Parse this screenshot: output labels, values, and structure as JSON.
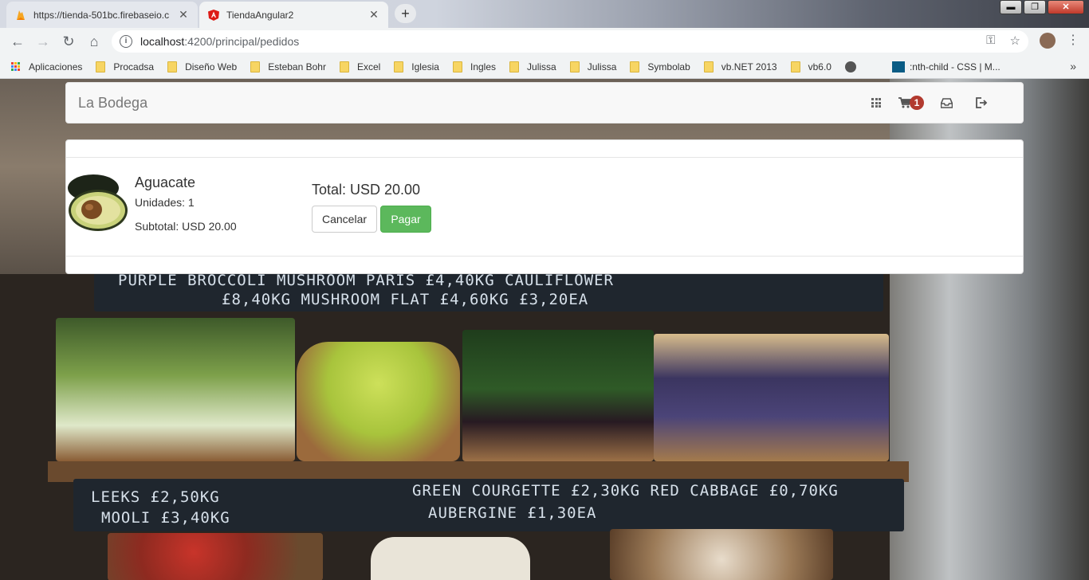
{
  "browser": {
    "tabs": [
      {
        "title": "https://tienda-501bc.firebaseio.c",
        "active": false,
        "icon": "firebase-icon"
      },
      {
        "title": "TiendaAngular2",
        "active": true,
        "icon": "angular-icon"
      }
    ],
    "new_tab": "+",
    "window_controls": {
      "minimize": "▬",
      "maximize": "❐",
      "close": "✕"
    },
    "url_host": "localhost",
    "url_path": ":4200/principal/pedidos",
    "bookmarks": [
      "Aplicaciones",
      "Procadsa",
      "Diseño Web",
      "Esteban Bohr",
      "Excel",
      "Iglesia",
      "Ingles",
      "Julissa",
      "Julissa",
      "Symbolab",
      "vb.NET 2013",
      "vb6.0",
      ":nth-child - CSS | M..."
    ],
    "bookmarks_more": "»"
  },
  "app": {
    "brand": "La Bodega",
    "cart_count": "1",
    "nav_icons": [
      "grid-icon",
      "cart-icon",
      "inbox-icon",
      "logout-icon"
    ]
  },
  "order": {
    "product_name": "Aguacate",
    "units": "Unidades: 1",
    "subtotal": "Subtotal: USD 20.00",
    "total": "Total: USD 20.00",
    "cancel_label": "Cancelar",
    "pay_label": "Pagar"
  },
  "background": {
    "board_top_line1": "PURPLE BROCCOLI      MUSHROOM PARIS £4,40KG   CAULIFLOWER",
    "board_top_line2": "£8,40KG       MUSHROOM FLAT £4,60KG     £3,20EA",
    "board_bottom_left1": "LEEKS £2,50KG",
    "board_bottom_left2": "MOOLI £3,40KG",
    "board_bottom_right1": "GREEN COURGETTE £2,30KG   RED CABBAGE £0,70KG",
    "board_bottom_right2": "AUBERGINE £1,30EA"
  },
  "colors": {
    "pay_button": "#5cb85c",
    "badge": "#b23a2f",
    "navbar_bg": "#f8f8f8"
  }
}
